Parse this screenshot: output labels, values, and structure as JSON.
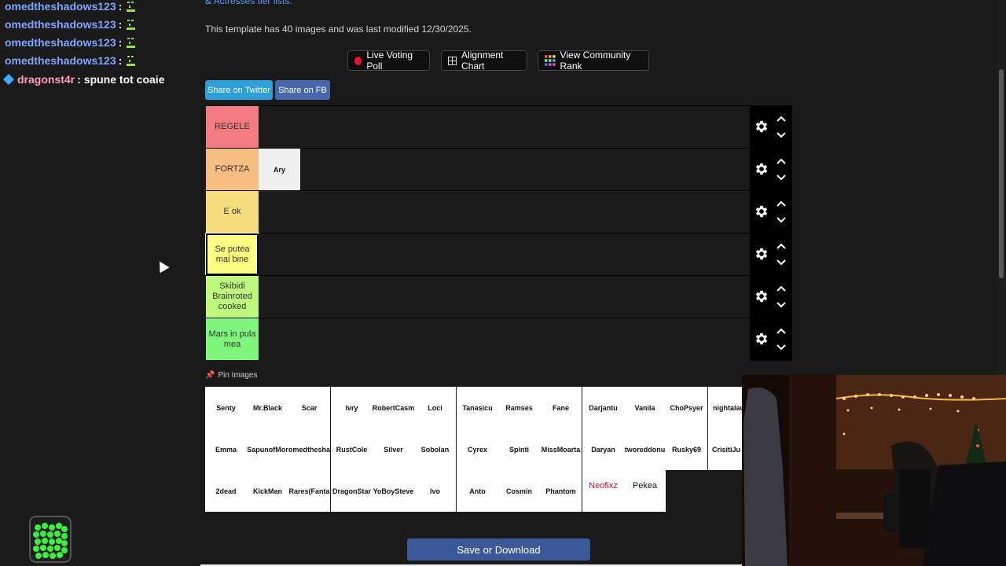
{
  "chat": {
    "lines": [
      {
        "user": "omedtheshadows123",
        "sep": ":",
        "msg": ""
      },
      {
        "user": "omedtheshadows123",
        "sep": ":",
        "msg": ""
      },
      {
        "user": "omedtheshadows123",
        "sep": ":",
        "msg": ""
      },
      {
        "user": "omedtheshadows123",
        "sep": ":",
        "msg": ""
      },
      {
        "user": "dragonst4r",
        "sep": ":",
        "msg": "spune tot coaie"
      }
    ],
    "colors": {
      "user": "#7fa6ff",
      "alt_user": "#ff9ec2",
      "emote": "#9be04a"
    }
  },
  "header": {
    "top_link": "& Actresses tier lists.",
    "template_info": "This template has 40 images and was last modified 12/30/2025."
  },
  "actions": {
    "live_voting": "Live Voting Poll",
    "alignment_chart": "Alignment Chart",
    "community_rank": "View Community Rank",
    "share_twitter": "Share on Twitter",
    "share_fb": "Share on FB"
  },
  "tiers": [
    {
      "label": "REGELE",
      "color": "#f27b81",
      "items": []
    },
    {
      "label": "FORTZA",
      "color": "#f6bd80",
      "items": [
        "Ary"
      ]
    },
    {
      "label": "E ok",
      "color": "#f8dd7e",
      "items": []
    },
    {
      "label": "Se putea mai bine",
      "color": "#fafc81",
      "items": []
    },
    {
      "label": "Skibidi Brainroted cooked",
      "color": "#bef87e",
      "items": []
    },
    {
      "label": "Mars in pula mea",
      "color": "#7ff77d",
      "items": []
    }
  ],
  "pin_images_label": "Pin Images",
  "pool": [
    [
      "Senty",
      "Mr.Black",
      "Scar",
      "Ivry",
      "RobertCasm",
      "Loci",
      "Tanasicu",
      "Ramses",
      "Fane",
      "Darjantu",
      "Vanila",
      "ChoPsyer",
      "nightalau"
    ],
    [
      "Emma",
      "SapunofMor",
      "omedthesha",
      "RustCole",
      "Silver",
      "Sobolan",
      "Cyrex",
      "Spinti",
      "MissMoarta",
      "Daryan",
      "tworeddonu",
      "Rusky69",
      "CrisitiJu"
    ],
    [
      "2dead",
      "KickMan",
      "Rares(Fanta",
      "DragonStar",
      "YoBoySteve",
      "Ivo",
      "Anto",
      "Cosmin",
      "Phantom",
      "Neofixz",
      "Pekea"
    ]
  ],
  "save_button": "Save or Download",
  "colors": {
    "accent_link": "#5b9cff",
    "twitter": "#2d9fd9",
    "facebook": "#4867aa",
    "save": "#3b5998",
    "live_dot": "#e8102a"
  }
}
